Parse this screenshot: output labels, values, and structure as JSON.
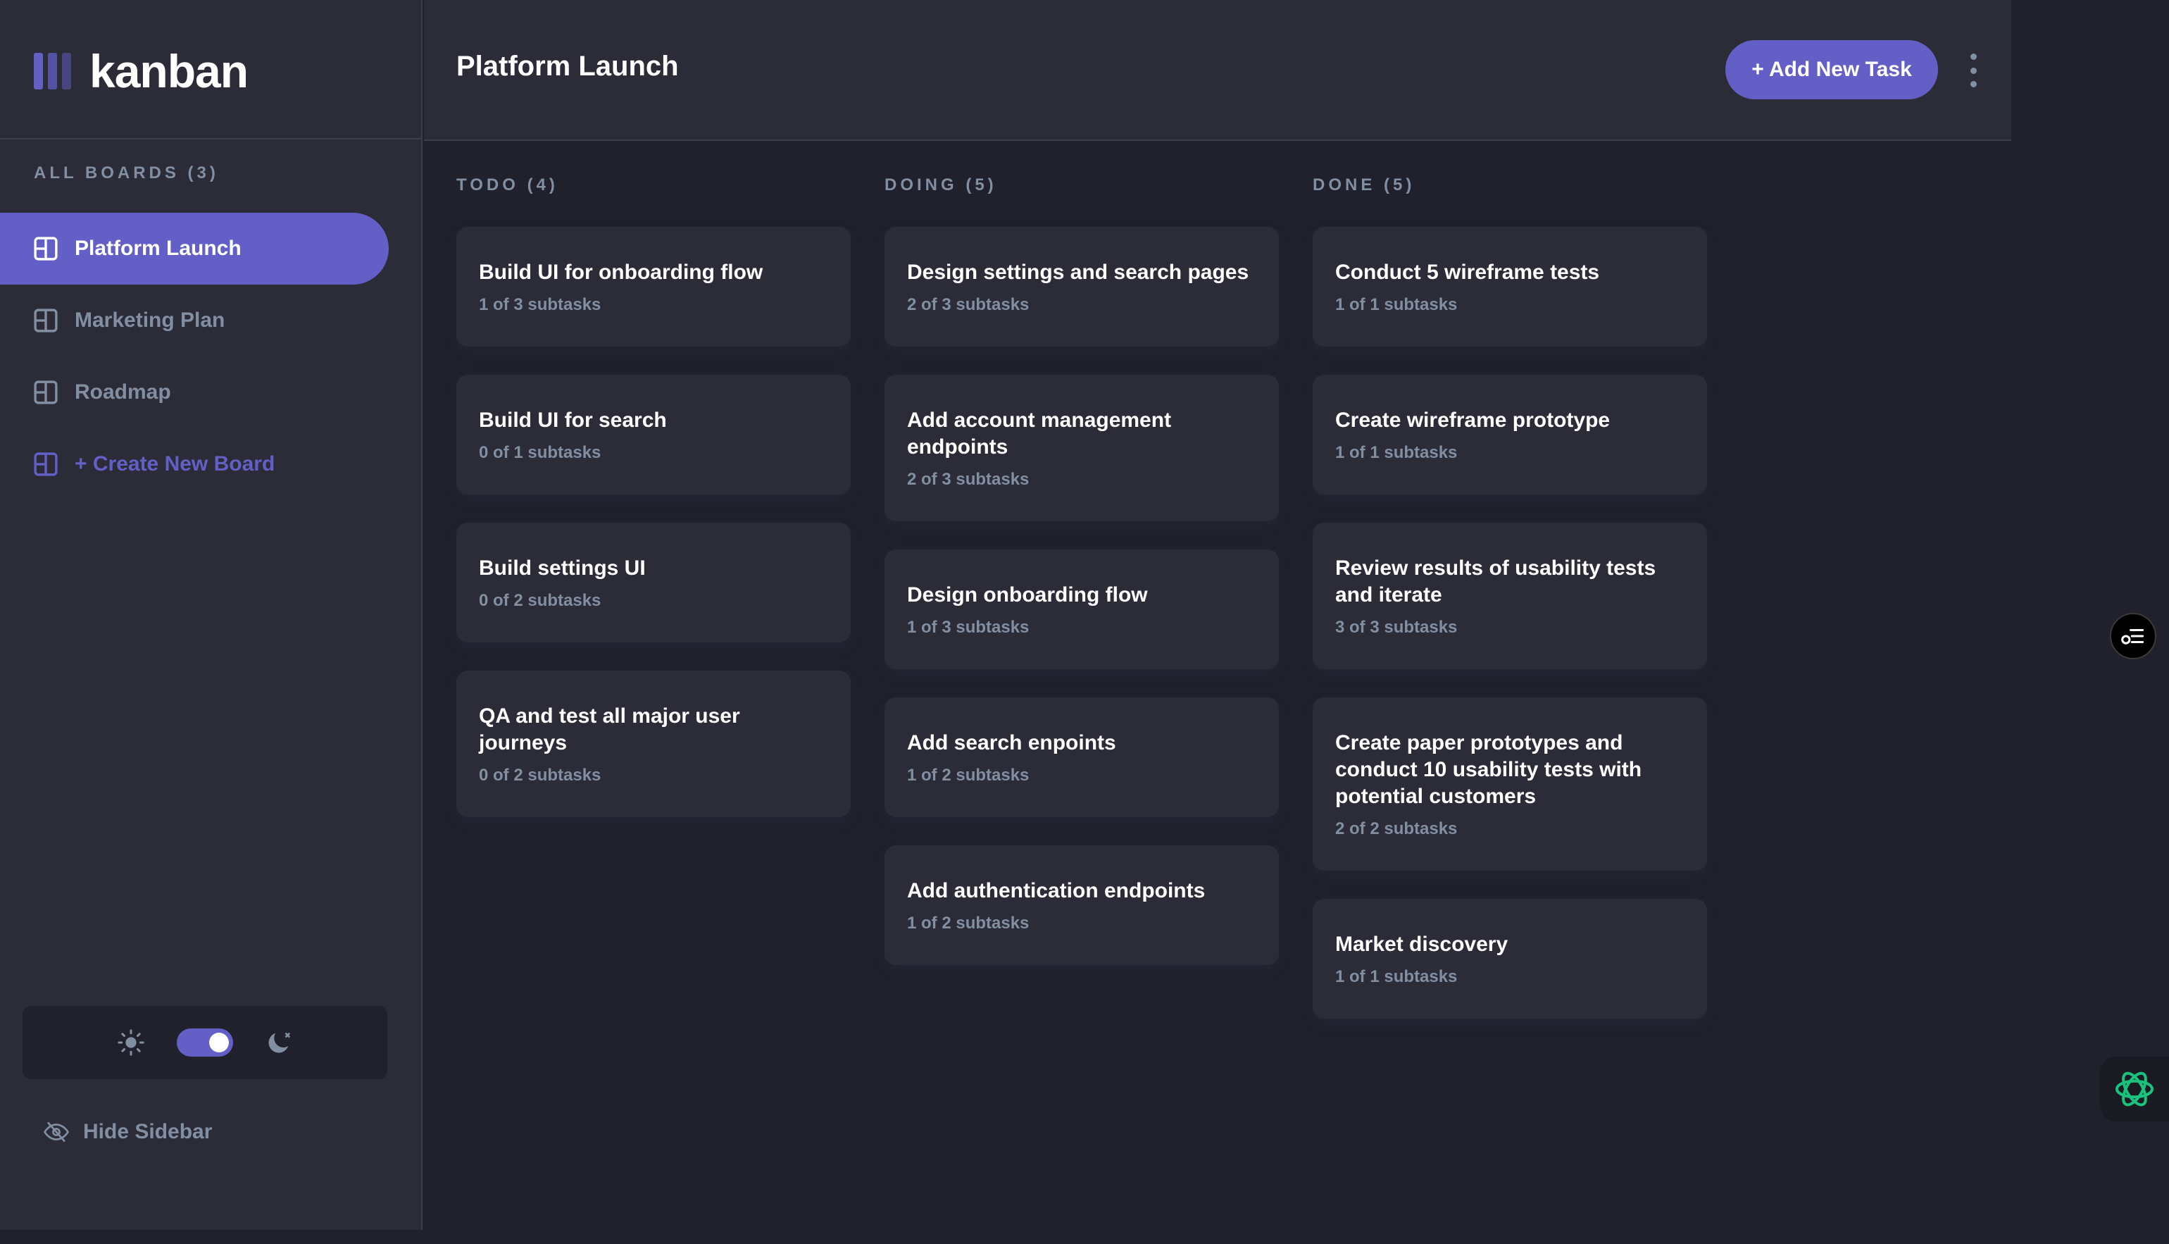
{
  "app": {
    "logo_text": "kanban",
    "brand_color": "#635fc7"
  },
  "sidebar": {
    "boards_heading": "ALL BOARDS (3)",
    "boards": [
      {
        "label": "Platform Launch",
        "active": true
      },
      {
        "label": "Marketing Plan",
        "active": false
      },
      {
        "label": "Roadmap",
        "active": false
      }
    ],
    "create_label": "+ Create New Board",
    "theme": {
      "mode": "dark",
      "light_icon": "sun-icon",
      "dark_icon": "moon-icon"
    },
    "hide_label": "Hide Sidebar"
  },
  "header": {
    "title": "Platform Launch",
    "add_task_label": "+ Add New Task",
    "more_icon": "vertical-ellipsis-icon"
  },
  "columns": [
    {
      "name": "TODO",
      "count": "(4)",
      "dot_color": "#49c4e5",
      "tasks": [
        {
          "title": "Build UI for onboarding flow",
          "subtasks": "1 of 3 subtasks"
        },
        {
          "title": "Build UI for search",
          "subtasks": "0 of 1 subtasks"
        },
        {
          "title": "Build settings UI",
          "subtasks": "0 of 2 subtasks"
        },
        {
          "title": "QA and test all major user journeys",
          "subtasks": "0 of 2 subtasks"
        }
      ]
    },
    {
      "name": "DOING",
      "count": "(5)",
      "dot_color": "#8471f2",
      "tasks": [
        {
          "title": "Design settings and search pages",
          "subtasks": "2 of 3 subtasks"
        },
        {
          "title": "Add account management endpoints",
          "subtasks": "2 of 3 subtasks"
        },
        {
          "title": "Design onboarding flow",
          "subtasks": "1 of 3 subtasks"
        },
        {
          "title": "Add search enpoints",
          "subtasks": "1 of 2 subtasks"
        },
        {
          "title": "Add authentication endpoints",
          "subtasks": "1 of 2 subtasks"
        }
      ]
    },
    {
      "name": "DONE",
      "count": "(5)",
      "dot_color": "#67e2ae",
      "tasks": [
        {
          "title": "Conduct 5 wireframe tests",
          "subtasks": "1 of 1 subtasks"
        },
        {
          "title": "Create wireframe prototype",
          "subtasks": "1 of 1 subtasks"
        },
        {
          "title": "Review results of usability tests and iterate",
          "subtasks": "3 of 3 subtasks"
        },
        {
          "title": "Create paper prototypes and conduct 10 usability tests with potential customers",
          "subtasks": "2 of 2 subtasks"
        },
        {
          "title": "Market discovery",
          "subtasks": "1 of 1 subtasks"
        }
      ]
    }
  ],
  "widgets": {
    "float_icon": "list-settings-icon",
    "assistant_icon": "assistant-logo-icon"
  }
}
